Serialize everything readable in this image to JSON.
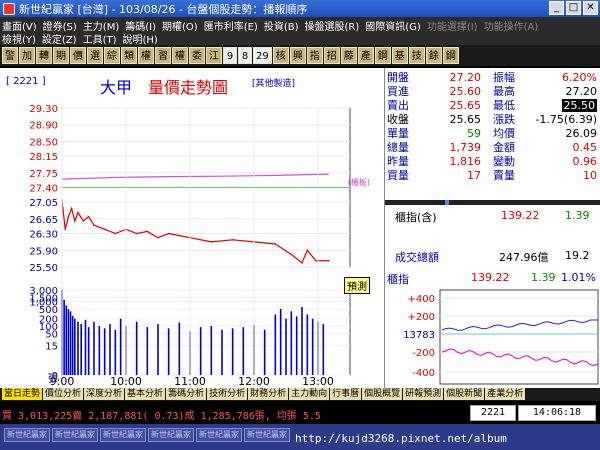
{
  "window": {
    "title": "新世紀贏家 [台灣] - 103/08/26 - 台盤個股走勢：播報順序"
  },
  "menu": {
    "row1": [
      "畫面(V)",
      "證券(S)",
      "主力(M)",
      "籌碼(I)",
      "期權(O)",
      "匯市利率(E)",
      "投資(B)",
      "操盤選股(R)",
      "國際資訊(G)",
      "功能選擇(I)",
      "功能操作(A)"
    ],
    "row2": [
      "檢視(Y)",
      "設定(Z)",
      "工具(T)",
      "說明(H)"
    ]
  },
  "toolbar": [
    "警",
    "加",
    "轉",
    "期",
    "價",
    "選",
    "綜",
    "類",
    "權",
    "習",
    "權",
    "委",
    "江",
    "9",
    "8",
    "29",
    "核",
    "興",
    "指",
    "招",
    "藤",
    "產",
    "鋼",
    "基",
    "技",
    "餘",
    "鋼"
  ],
  "stock": {
    "code": "[ 2221 ]",
    "name": "大甲",
    "chart_title": "量價走勢圖",
    "note": "[其他製造]",
    "ref_label": "(機板)",
    "predict": "預測"
  },
  "quotes": [
    {
      "l1": "開盤",
      "v1": "27.20",
      "l2": "振幅",
      "v2": "6.20%"
    },
    {
      "l1": "買進",
      "v1": "25.60",
      "l2": "最高",
      "v2": "27.20"
    },
    {
      "l1": "賣出",
      "v1": "25.65",
      "l2": "最低",
      "v2": "25.50"
    },
    {
      "l1": "收盤",
      "v1": "25.65",
      "l2": "漲跌",
      "v2": "-1.75(6.39)"
    },
    {
      "l1": "單量",
      "v1": "59",
      "l2": "均價",
      "v2": "26.09"
    },
    {
      "l1": "總量",
      "v1": "1,739",
      "l2": "金額",
      "v2": "0.45"
    },
    {
      "l1": "昨量",
      "v1": "1,816",
      "l2": "變動",
      "v2": "0.96"
    },
    {
      "l1": "買量",
      "v1": "17",
      "l2": "賣量",
      "v2": "10"
    }
  ],
  "index": {
    "label": "櫃指(含)",
    "value": "139.22",
    "change": "1.39",
    "turnover_label": "成交總額",
    "turnover": "247.96億",
    "turnover_change": "19.2"
  },
  "mini_index": {
    "label": "櫃指",
    "value": "139.22",
    "change": "1.39",
    "pct": "1.01%",
    "base": "137.83",
    "axis": [
      "+400",
      "+200",
      "13783",
      "-200",
      "-400"
    ]
  },
  "tabs": [
    "當日走勢",
    "價位分析",
    "深度分析",
    "基本分析",
    "籌碼分析",
    "技術分析",
    "財務分析",
    "主力動向",
    "行事曆",
    "個股概覽",
    "研報預測",
    "個股新聞",
    "產業分析"
  ],
  "status": {
    "text": "買 3,013,225賣 2,187,881( 0.73)成 1,285,786張, 均張 5.5",
    "code": "2221",
    "time": "14:06:18"
  },
  "taskbar": [
    "新世紀贏家",
    "新世紀贏家",
    "新世紀贏家",
    "新世紀贏家",
    "新世紀贏家",
    "新世紀贏家"
  ],
  "url": "http://kujd3268.pixnet.net/album",
  "chart_data": {
    "type": "line",
    "price_axis": [
      "29.30",
      "28.90",
      "28.50",
      "28.15",
      "27.75",
      "27.40",
      "27.05",
      "26.65",
      "26.30",
      "25.90",
      "25.50"
    ],
    "volume_axis": [
      "3,000",
      "1,500",
      "1,000",
      "500",
      "200",
      "100",
      "50",
      "15",
      "0"
    ],
    "volume_unit": "張",
    "time_labels": [
      "9:00",
      "10:00",
      "11:00",
      "12:00",
      "13:00"
    ],
    "ref_price": 27.4,
    "price": [
      [
        0,
        27.1
      ],
      [
        3,
        26.4
      ],
      [
        6,
        26.7
      ],
      [
        9,
        26.9
      ],
      [
        12,
        26.6
      ],
      [
        15,
        26.8
      ],
      [
        20,
        26.6
      ],
      [
        25,
        26.7
      ],
      [
        30,
        26.5
      ],
      [
        40,
        26.4
      ],
      [
        50,
        26.3
      ],
      [
        60,
        26.4
      ],
      [
        70,
        26.3
      ],
      [
        80,
        26.35
      ],
      [
        90,
        26.2
      ],
      [
        100,
        26.3
      ],
      [
        110,
        26.25
      ],
      [
        120,
        26.2
      ],
      [
        140,
        26.1
      ],
      [
        160,
        26.15
      ],
      [
        180,
        26.1
      ],
      [
        200,
        26.05
      ],
      [
        215,
        25.8
      ],
      [
        225,
        25.6
      ],
      [
        230,
        25.9
      ],
      [
        238,
        25.65
      ],
      [
        250,
        25.65
      ]
    ],
    "avg": [
      [
        0,
        27.6
      ],
      [
        50,
        27.64
      ],
      [
        100,
        27.66
      ],
      [
        150,
        27.67
      ],
      [
        200,
        27.69
      ],
      [
        250,
        27.72
      ]
    ],
    "volume": [
      [
        0,
        3000
      ],
      [
        2,
        1200
      ],
      [
        4,
        700
      ],
      [
        6,
        500
      ],
      [
        8,
        400
      ],
      [
        10,
        260
      ],
      [
        12,
        200
      ],
      [
        15,
        150
      ],
      [
        18,
        120
      ],
      [
        22,
        180
      ],
      [
        25,
        90
      ],
      [
        30,
        150
      ],
      [
        35,
        100
      ],
      [
        40,
        80
      ],
      [
        45,
        120
      ],
      [
        50,
        70
      ],
      [
        55,
        200
      ],
      [
        60,
        100
      ],
      [
        70,
        150
      ],
      [
        80,
        90
      ],
      [
        90,
        120
      ],
      [
        100,
        80
      ],
      [
        110,
        140
      ],
      [
        120,
        60
      ],
      [
        130,
        90
      ],
      [
        140,
        100
      ],
      [
        150,
        70
      ],
      [
        160,
        80
      ],
      [
        170,
        90
      ],
      [
        180,
        110
      ],
      [
        190,
        70
      ],
      [
        200,
        300
      ],
      [
        205,
        500
      ],
      [
        210,
        200
      ],
      [
        215,
        400
      ],
      [
        220,
        250
      ],
      [
        225,
        600
      ],
      [
        230,
        300
      ],
      [
        235,
        200
      ],
      [
        240,
        150
      ],
      [
        245,
        120
      ]
    ]
  }
}
